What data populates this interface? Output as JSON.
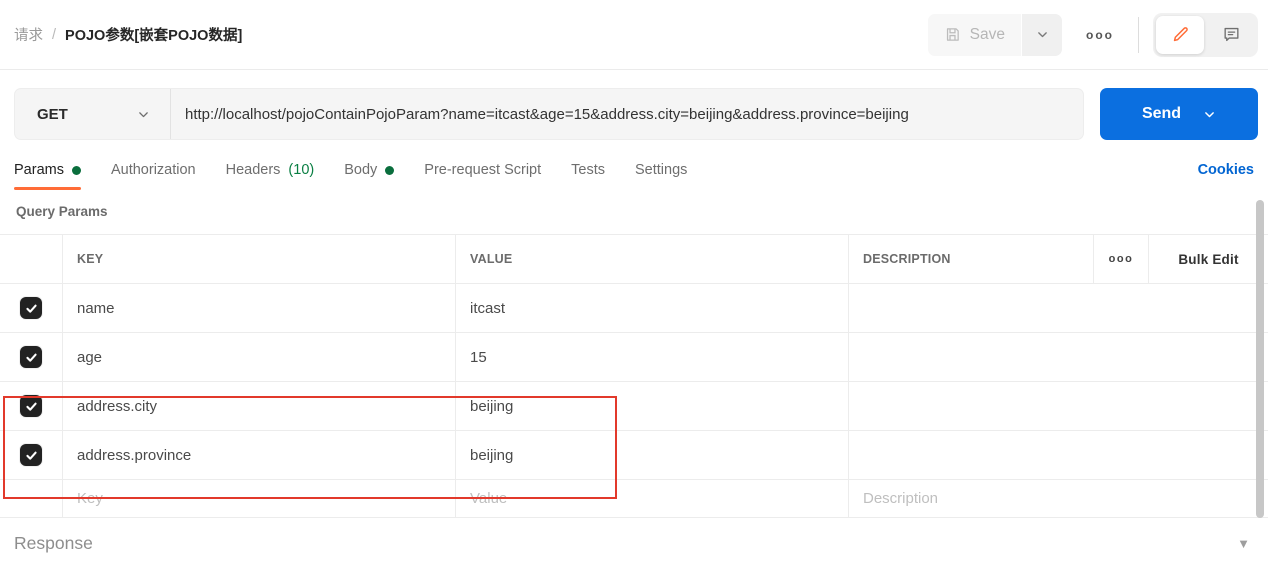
{
  "colors": {
    "accent_orange": "#ff6c37",
    "primary_blue": "#0b6fe0",
    "link_blue": "#0265d2",
    "success_green": "#0a6e3d",
    "annotation_red": "#e2392b"
  },
  "breadcrumb": {
    "section": "请求",
    "separator": "/",
    "request_title": "POJO参数[嵌套POJO数据]"
  },
  "header_toolbar": {
    "save_label": "Save",
    "more_options": "ooo"
  },
  "request_bar": {
    "method": "GET",
    "url": "http://localhost/pojoContainPojoParam?name=itcast&age=15&address.city=beijing&address.province=beijing",
    "send_label": "Send"
  },
  "request_tabs": {
    "params_label": "Params",
    "authorization_label": "Authorization",
    "headers_label": "Headers",
    "headers_count": "(10)",
    "body_label": "Body",
    "pre_request_label": "Pre-request Script",
    "tests_label": "Tests",
    "settings_label": "Settings",
    "cookies_link": "Cookies"
  },
  "query_params": {
    "section_label": "Query Params",
    "columns": {
      "key": "KEY",
      "value": "VALUE",
      "description": "DESCRIPTION"
    },
    "more_options": "ooo",
    "bulk_edit_label": "Bulk Edit",
    "rows": [
      {
        "key": "name",
        "value": "itcast",
        "description": "",
        "checked": true
      },
      {
        "key": "age",
        "value": "15",
        "description": "",
        "checked": true
      },
      {
        "key": "address.city",
        "value": "beijing",
        "description": "",
        "checked": true,
        "highlighted": true
      },
      {
        "key": "address.province",
        "value": "beijing",
        "description": "",
        "checked": true,
        "highlighted": true
      }
    ],
    "new_row": {
      "key_placeholder": "Key",
      "value_placeholder": "Value",
      "description_placeholder": "Description"
    }
  },
  "response_section": {
    "label": "Response",
    "collapse_icon": "▼"
  }
}
